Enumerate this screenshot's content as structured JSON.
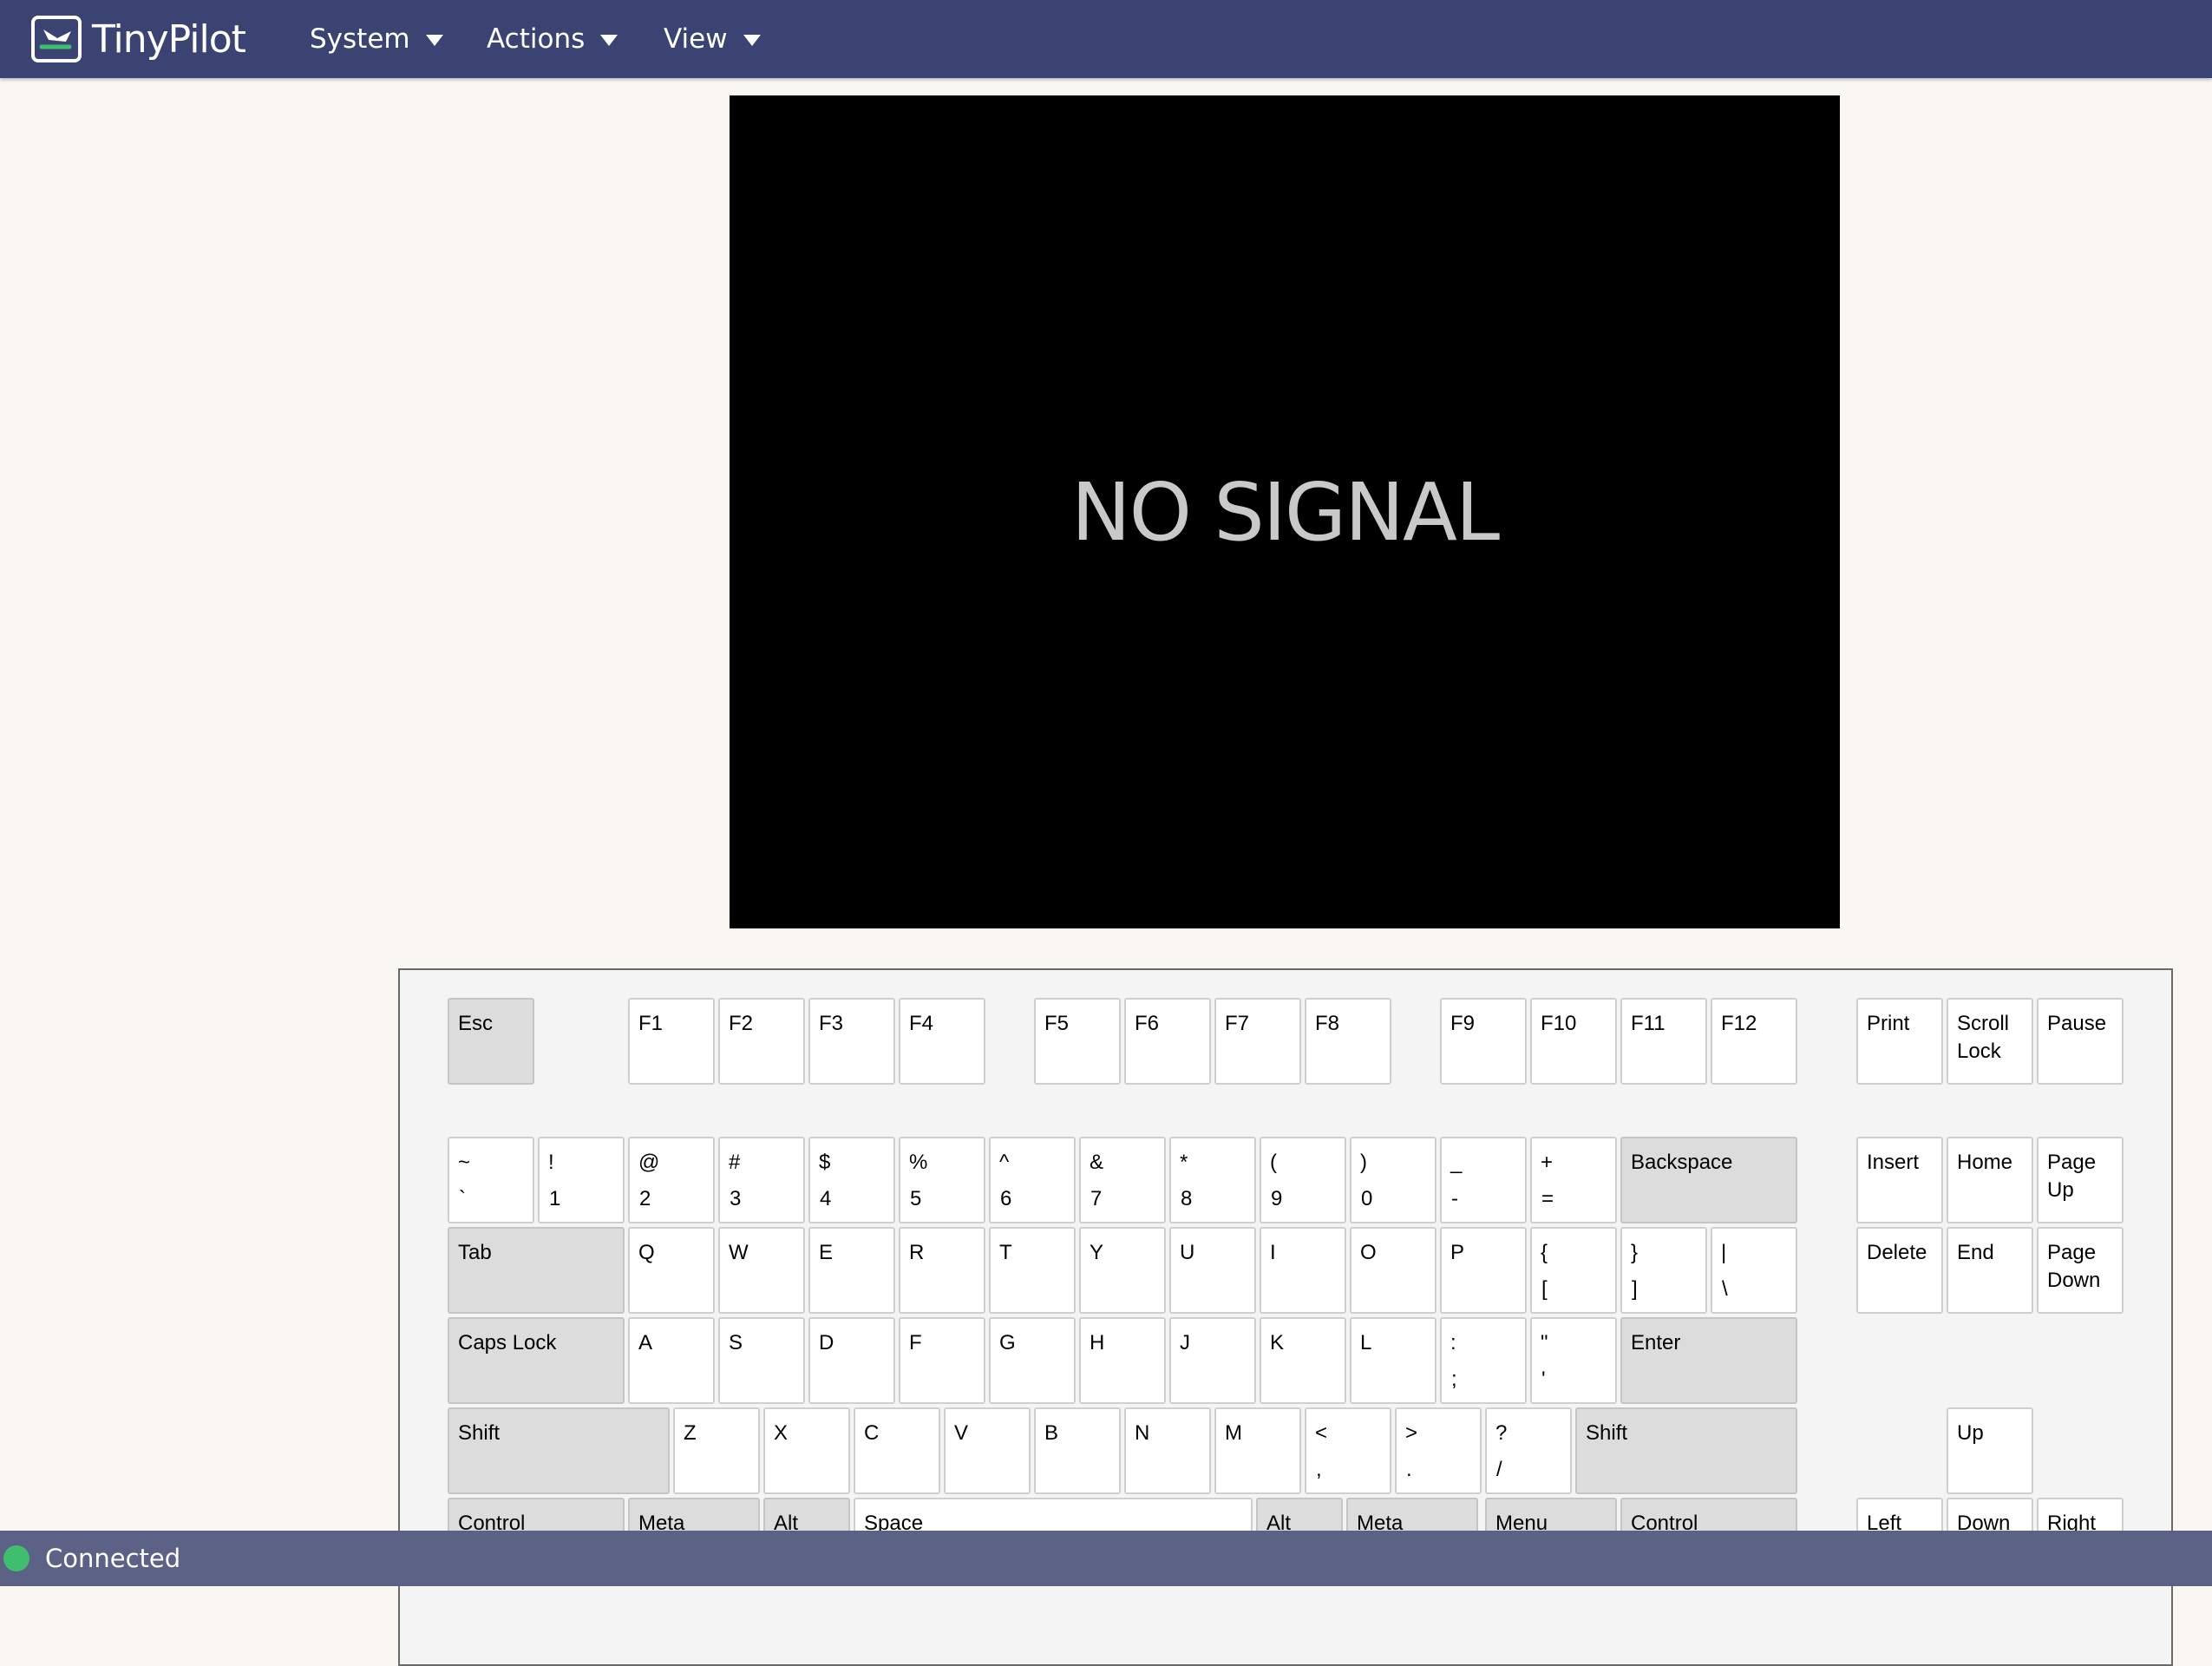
{
  "app": {
    "brand": "TinyPilot"
  },
  "menu": [
    {
      "label": "System"
    },
    {
      "label": "Actions"
    },
    {
      "label": "View"
    }
  ],
  "screen": {
    "message": "NO SIGNAL"
  },
  "keyboard": {
    "keys": [
      {
        "id": "esc",
        "top": "Esc"
      },
      {
        "id": "f1",
        "top": "F1"
      },
      {
        "id": "f2",
        "top": "F2"
      },
      {
        "id": "f3",
        "top": "F3"
      },
      {
        "id": "f4",
        "top": "F4"
      },
      {
        "id": "f5",
        "top": "F5"
      },
      {
        "id": "f6",
        "top": "F6"
      },
      {
        "id": "f7",
        "top": "F7"
      },
      {
        "id": "f8",
        "top": "F8"
      },
      {
        "id": "f9",
        "top": "F9"
      },
      {
        "id": "f10",
        "top": "F10"
      },
      {
        "id": "f11",
        "top": "F11"
      },
      {
        "id": "f12",
        "top": "F12"
      },
      {
        "id": "print",
        "top": "Print"
      },
      {
        "id": "scroll-lock",
        "top": "Scroll",
        "line2": "Lock"
      },
      {
        "id": "pause",
        "top": "Pause"
      },
      {
        "id": "backquote",
        "top": "~",
        "bottom": "`"
      },
      {
        "id": "digit1",
        "top": "!",
        "bottom": "1"
      },
      {
        "id": "digit2",
        "top": "@",
        "bottom": "2"
      },
      {
        "id": "digit3",
        "top": "#",
        "bottom": "3"
      },
      {
        "id": "digit4",
        "top": "$",
        "bottom": "4"
      },
      {
        "id": "digit5",
        "top": "%",
        "bottom": "5"
      },
      {
        "id": "digit6",
        "top": "^",
        "bottom": "6"
      },
      {
        "id": "digit7",
        "top": "&",
        "bottom": "7"
      },
      {
        "id": "digit8",
        "top": "*",
        "bottom": "8"
      },
      {
        "id": "digit9",
        "top": "(",
        "bottom": "9"
      },
      {
        "id": "digit0",
        "top": ")",
        "bottom": "0"
      },
      {
        "id": "minus",
        "top": "_",
        "bottom": "-"
      },
      {
        "id": "equal",
        "top": "+",
        "bottom": "="
      },
      {
        "id": "backspace",
        "top": "Backspace"
      },
      {
        "id": "insert",
        "top": "Insert"
      },
      {
        "id": "home",
        "top": "Home"
      },
      {
        "id": "page-up",
        "top": "Page",
        "line2": "Up"
      },
      {
        "id": "tab",
        "top": "Tab"
      },
      {
        "id": "q",
        "top": "Q"
      },
      {
        "id": "w",
        "top": "W"
      },
      {
        "id": "e",
        "top": "E"
      },
      {
        "id": "r",
        "top": "R"
      },
      {
        "id": "t",
        "top": "T"
      },
      {
        "id": "y",
        "top": "Y"
      },
      {
        "id": "u",
        "top": "U"
      },
      {
        "id": "i",
        "top": "I"
      },
      {
        "id": "o",
        "top": "O"
      },
      {
        "id": "p",
        "top": "P"
      },
      {
        "id": "bracket-left",
        "top": "{",
        "bottom": "["
      },
      {
        "id": "bracket-right",
        "top": "}",
        "bottom": "]"
      },
      {
        "id": "backslash",
        "top": "|",
        "bottom": "\\"
      },
      {
        "id": "delete",
        "top": "Delete"
      },
      {
        "id": "end",
        "top": "End"
      },
      {
        "id": "page-down",
        "top": "Page",
        "line2": "Down"
      },
      {
        "id": "caps-lock",
        "top": "Caps Lock"
      },
      {
        "id": "a",
        "top": "A"
      },
      {
        "id": "s",
        "top": "S"
      },
      {
        "id": "d",
        "top": "D"
      },
      {
        "id": "f",
        "top": "F"
      },
      {
        "id": "g",
        "top": "G"
      },
      {
        "id": "h",
        "top": "H"
      },
      {
        "id": "j",
        "top": "J"
      },
      {
        "id": "k",
        "top": "K"
      },
      {
        "id": "l",
        "top": "L"
      },
      {
        "id": "semicolon",
        "top": ":",
        "bottom": ";"
      },
      {
        "id": "quote",
        "top": "\"",
        "bottom": "'"
      },
      {
        "id": "enter",
        "top": "Enter"
      },
      {
        "id": "shift-left",
        "top": "Shift"
      },
      {
        "id": "z",
        "top": "Z"
      },
      {
        "id": "x",
        "top": "X"
      },
      {
        "id": "c",
        "top": "C"
      },
      {
        "id": "v",
        "top": "V"
      },
      {
        "id": "b",
        "top": "B"
      },
      {
        "id": "n",
        "top": "N"
      },
      {
        "id": "m",
        "top": "M"
      },
      {
        "id": "comma",
        "top": "<",
        "bottom": ","
      },
      {
        "id": "period",
        "top": ">",
        "bottom": "."
      },
      {
        "id": "slash",
        "top": "?",
        "bottom": "/"
      },
      {
        "id": "shift-right",
        "top": "Shift"
      },
      {
        "id": "arrow-up",
        "top": "Up"
      },
      {
        "id": "control-left",
        "top": "Control"
      },
      {
        "id": "meta-left",
        "top": "Meta"
      },
      {
        "id": "alt-left",
        "top": "Alt"
      },
      {
        "id": "space",
        "top": "Space"
      },
      {
        "id": "alt-right",
        "top": "Alt"
      },
      {
        "id": "meta-right",
        "top": "Meta"
      },
      {
        "id": "menu",
        "top": "Menu"
      },
      {
        "id": "control-right",
        "top": "Control"
      },
      {
        "id": "arrow-left",
        "top": "Left"
      },
      {
        "id": "arrow-down",
        "top": "Down"
      },
      {
        "id": "arrow-right",
        "top": "Right"
      }
    ]
  },
  "status": {
    "label": "Connected",
    "color": "#3fbf6d"
  }
}
